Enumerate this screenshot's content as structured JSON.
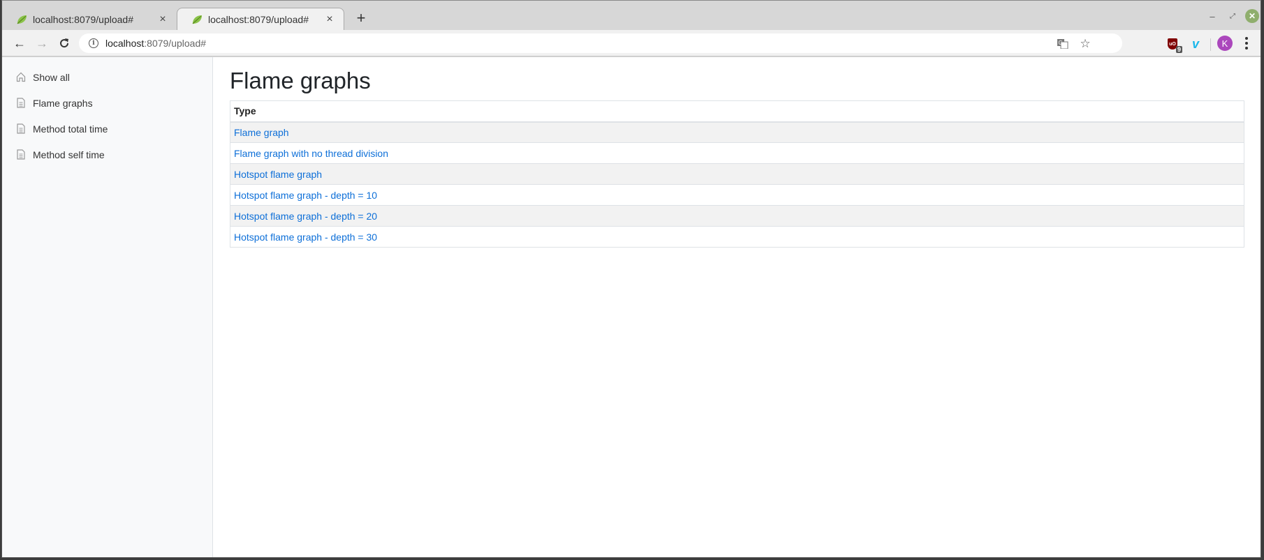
{
  "browser": {
    "tabs": [
      {
        "title": "localhost:8079/upload#",
        "active": false
      },
      {
        "title": "localhost:8079/upload#",
        "active": true
      }
    ],
    "new_tab_label": "+",
    "close_glyph": "×",
    "url": {
      "host": "localhost",
      "path": ":8079/upload#"
    },
    "extensions": {
      "ublock_badge": "9",
      "ublock_label": "uO"
    },
    "profile_initial": "K",
    "icons": {
      "back": "←",
      "forward": "→",
      "reload": "C",
      "info": "i",
      "translate": "G",
      "star": "☆",
      "vimeo": "v",
      "minimize": "–",
      "maximize": "⤢",
      "close": "✕"
    }
  },
  "sidebar": {
    "items": [
      {
        "label": "Show all",
        "icon": "home-icon"
      },
      {
        "label": "Flame graphs",
        "icon": "document-icon"
      },
      {
        "label": "Method total time",
        "icon": "document-icon"
      },
      {
        "label": "Method self time",
        "icon": "document-icon"
      }
    ]
  },
  "main": {
    "title": "Flame graphs",
    "table": {
      "header": "Type",
      "rows": [
        "Flame graph",
        "Flame graph with no thread division",
        "Hotspot flame graph",
        "Hotspot flame graph - depth = 10",
        "Hotspot flame graph - depth = 20",
        "Hotspot flame graph - depth = 30"
      ]
    }
  },
  "colors": {
    "link": "#0d6fd8",
    "sidebar_bg": "#f8f9fa",
    "avatar": "#ab47bc",
    "ublock": "#800000",
    "vimeo": "#1ab7ea"
  }
}
